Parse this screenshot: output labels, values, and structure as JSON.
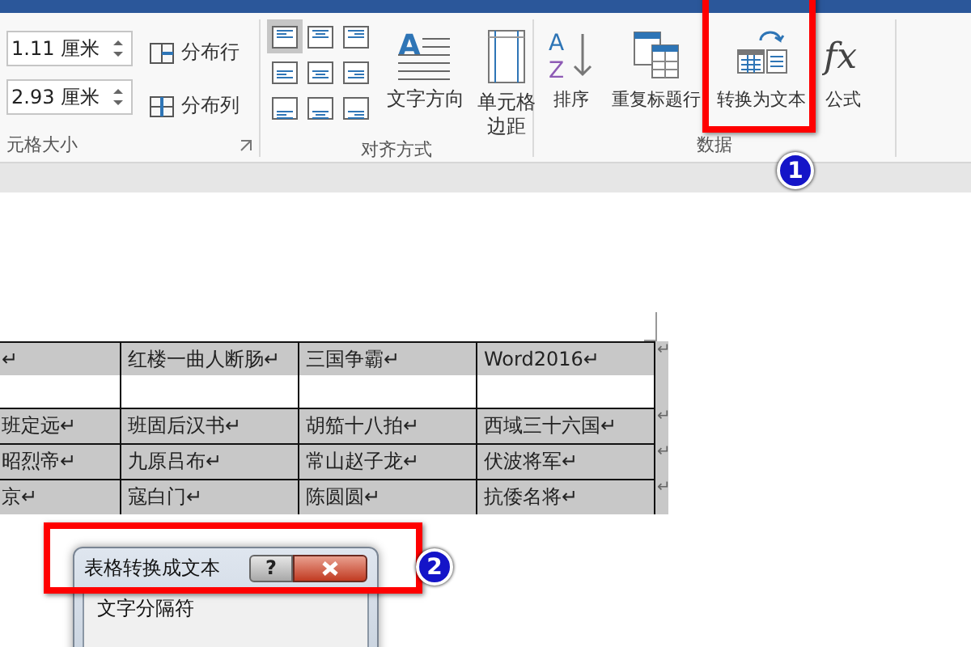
{
  "ribbon": {
    "cell_size": {
      "fields": [
        {
          "value": "1.11 厘米"
        },
        {
          "value": "2.93 厘米"
        }
      ],
      "buttons": [
        {
          "kind": "rows",
          "label": "分布行"
        },
        {
          "kind": "columns",
          "label": "分布列"
        }
      ],
      "label": "元格大小"
    },
    "alignment": {
      "options": [
        {
          "selected": true
        },
        {
          "selected": false
        },
        {
          "selected": false
        },
        {
          "selected": false
        },
        {
          "selected": false
        },
        {
          "selected": false
        },
        {
          "selected": false
        },
        {
          "selected": false
        },
        {
          "selected": false
        }
      ],
      "buttons": [
        {
          "kind": "direction",
          "icon_text": [
            "A"
          ],
          "lines": [
            "文字方向"
          ]
        },
        {
          "kind": "margins",
          "lines": [
            "单元格",
            "边距"
          ]
        }
      ],
      "label": "对齐方式"
    },
    "data": {
      "buttons": [
        {
          "kind": "sort",
          "icon_text": [
            "A",
            "Z"
          ],
          "lines": [
            "排序"
          ]
        },
        {
          "kind": "repeat",
          "lines": [
            "重复标题行"
          ]
        },
        {
          "kind": "convert",
          "lines": [
            "转换为文本"
          ]
        },
        {
          "kind": "formula",
          "icon_text": [
            "fx"
          ],
          "lines": [
            "公式"
          ]
        }
      ],
      "label": "数据"
    }
  },
  "table": {
    "rows": [
      {
        "cells": [
          "↵",
          "红楼一曲人断肠↵",
          "三国争霸↵",
          "Word2016↵"
        ],
        "end": "↵"
      },
      {
        "cells": [
          "班定远↵",
          "班固后汉书↵",
          "胡笳十八拍↵",
          "西域三十六国↵"
        ],
        "end": "↵"
      },
      {
        "cells": [
          "昭烈帝↵",
          "九原吕布↵",
          "常山赵子龙↵",
          "伏波将军↵"
        ],
        "end": "↵"
      },
      {
        "cells": [
          "京↵",
          "寇白门↵",
          "陈圆圆↵",
          "抗倭名将↵"
        ],
        "end": "↵"
      }
    ]
  },
  "dialog": {
    "title": "表格转换成文本",
    "help": "?",
    "section": "文字分隔符"
  },
  "annotations": [
    {
      "number": "1"
    },
    {
      "number": "2"
    }
  ]
}
